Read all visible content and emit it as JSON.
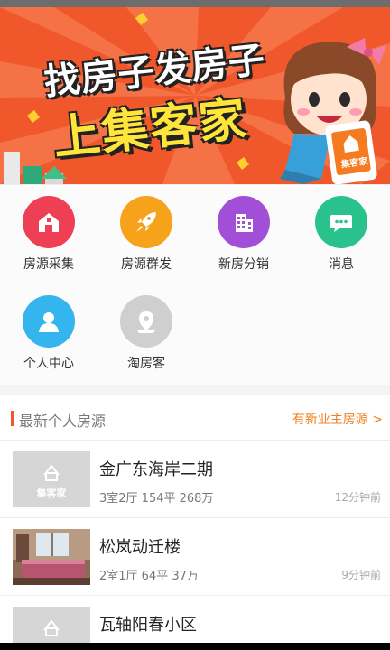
{
  "banner": {
    "headline_top": "找房子发房子",
    "headline_bottom": "上集客家",
    "phone_logo_text": "集客家"
  },
  "grid": {
    "items": [
      {
        "label": "房源采集",
        "icon": "home-icon",
        "color": "#ee3f55"
      },
      {
        "label": "房源群发",
        "icon": "rocket-icon",
        "color": "#f7a21b"
      },
      {
        "label": "新房分销",
        "icon": "building-icon",
        "color": "#a14fd6"
      },
      {
        "label": "消息",
        "icon": "chat-icon",
        "color": "#2ac28c"
      },
      {
        "label": "个人中心",
        "icon": "person-icon",
        "color": "#35b5ee"
      },
      {
        "label": "淘房客",
        "icon": "location-pin-icon",
        "color": "#cfcfcf"
      }
    ]
  },
  "section": {
    "title": "最新个人房源",
    "more_link": "有新业主房源 >"
  },
  "listings": [
    {
      "name": "金广东海岸二期",
      "info": "3室2厅  154平  268万",
      "time": "12分钟前",
      "thumb": "placeholder",
      "thumb_text": "集客家"
    },
    {
      "name": "松岚动迁楼",
      "info": "2室1厅  64平  37万",
      "time": "9分钟前",
      "thumb": "photo"
    },
    {
      "name": "瓦轴阳春小区",
      "info": "",
      "time": "",
      "thumb": "placeholder",
      "thumb_text": ""
    }
  ],
  "colors": {
    "accent": "#f0582b",
    "link": "#f08020"
  }
}
